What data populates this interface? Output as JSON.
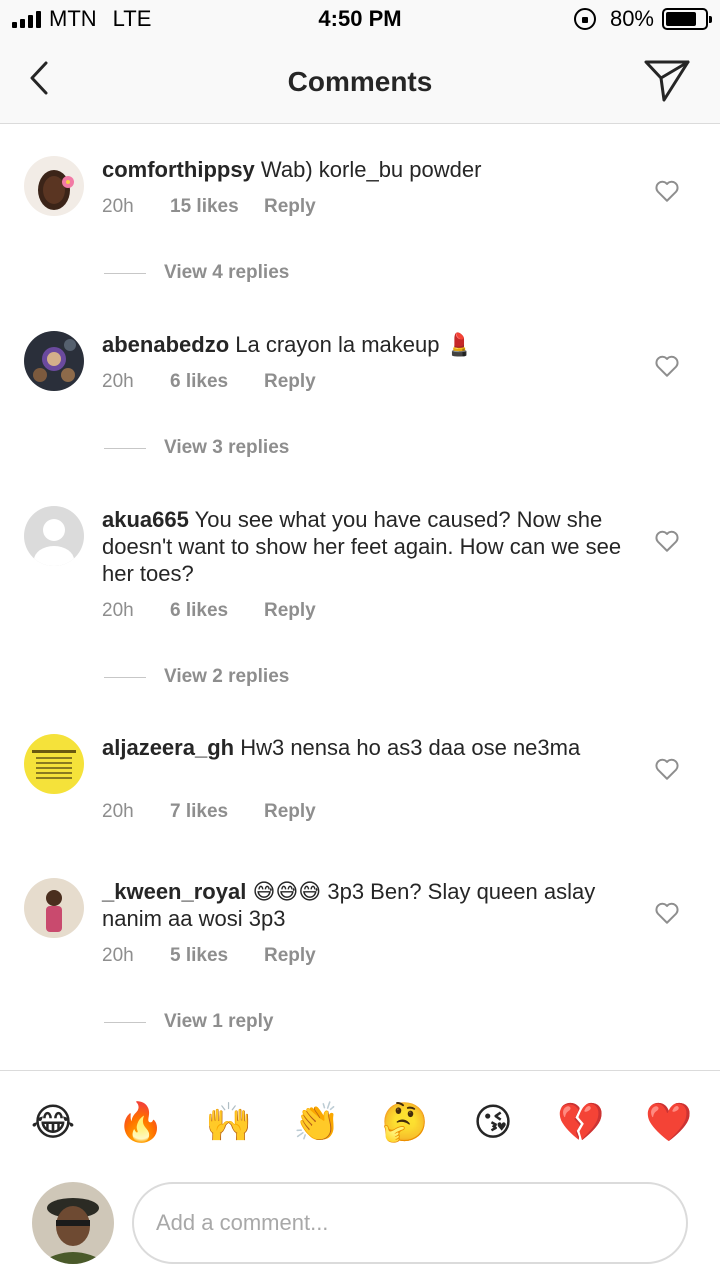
{
  "status_bar": {
    "carrier": "MTN",
    "network": "LTE",
    "time": "4:50 PM",
    "battery": "80%",
    "battery_level": 0.8
  },
  "nav": {
    "title": "Comments",
    "back_icon": "chevron-left-icon",
    "send_icon": "direct-send-icon"
  },
  "comments": [
    {
      "username": "comforthippsy",
      "text": "Wab) korle_bu powder",
      "time": "20h",
      "likes": "15 likes",
      "reply": "Reply",
      "view_replies": "View 4 replies"
    },
    {
      "username": "abenabedzo",
      "text": "La crayon la makeup 💄",
      "time": "20h",
      "likes": "6 likes",
      "reply": "Reply",
      "view_replies": "View 3 replies"
    },
    {
      "username": "akua665",
      "text": "You see what you have caused? Now she doesn't want to show her feet again. How can we see her toes?",
      "time": "20h",
      "likes": "6 likes",
      "reply": "Reply",
      "view_replies": "View 2 replies"
    },
    {
      "username": "aljazeera_gh",
      "text": "Hw3 nensa ho as3 daa ose ne3ma",
      "time": "20h",
      "likes": "7 likes",
      "reply": "Reply"
    },
    {
      "username": "_kween_royal",
      "text": "😅😅😅 3p3 Ben? Slay queen aslay nanim aa wosi 3p3",
      "time": "20h",
      "likes": "5 likes",
      "reply": "Reply",
      "view_replies": "View 1 reply"
    }
  ],
  "emoji_bar": [
    "😂",
    "🔥",
    "🙌",
    "👏",
    "🤔",
    "😘",
    "💔",
    "❤️"
  ],
  "composer": {
    "placeholder": "Add a comment..."
  }
}
